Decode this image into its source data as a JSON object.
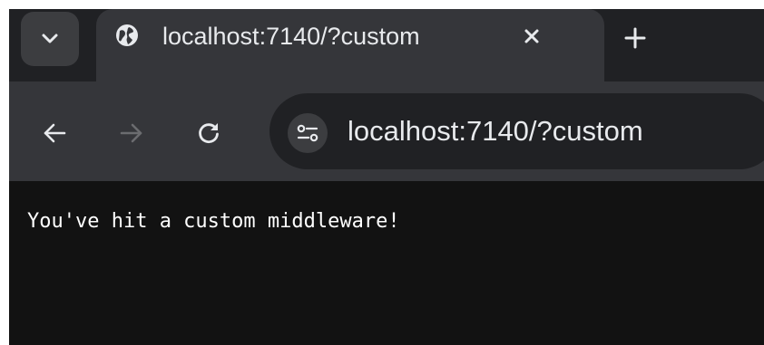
{
  "browser": {
    "tab": {
      "title": "localhost:7140/?custom",
      "favicon": "globe-icon"
    },
    "tab_search_icon": "chevron-down-icon",
    "close_tab_icon": "close-icon",
    "new_tab_icon": "plus-icon",
    "nav": {
      "back_icon": "arrow-left-icon",
      "forward_icon": "arrow-right-icon",
      "reload_icon": "reload-icon",
      "forward_enabled": false
    },
    "address_bar": {
      "url": "localhost:7140/?custom",
      "site_info_icon": "tune-icon"
    }
  },
  "page": {
    "body_text": "You've hit a custom middleware!"
  },
  "colors": {
    "tabstrip": "#202124",
    "active_tab": "#35363a",
    "toolbar": "#35363a",
    "omnibox": "#202124",
    "content_bg": "#121212",
    "text": "#e8eaed",
    "disabled_icon": "#6b6c6f"
  }
}
